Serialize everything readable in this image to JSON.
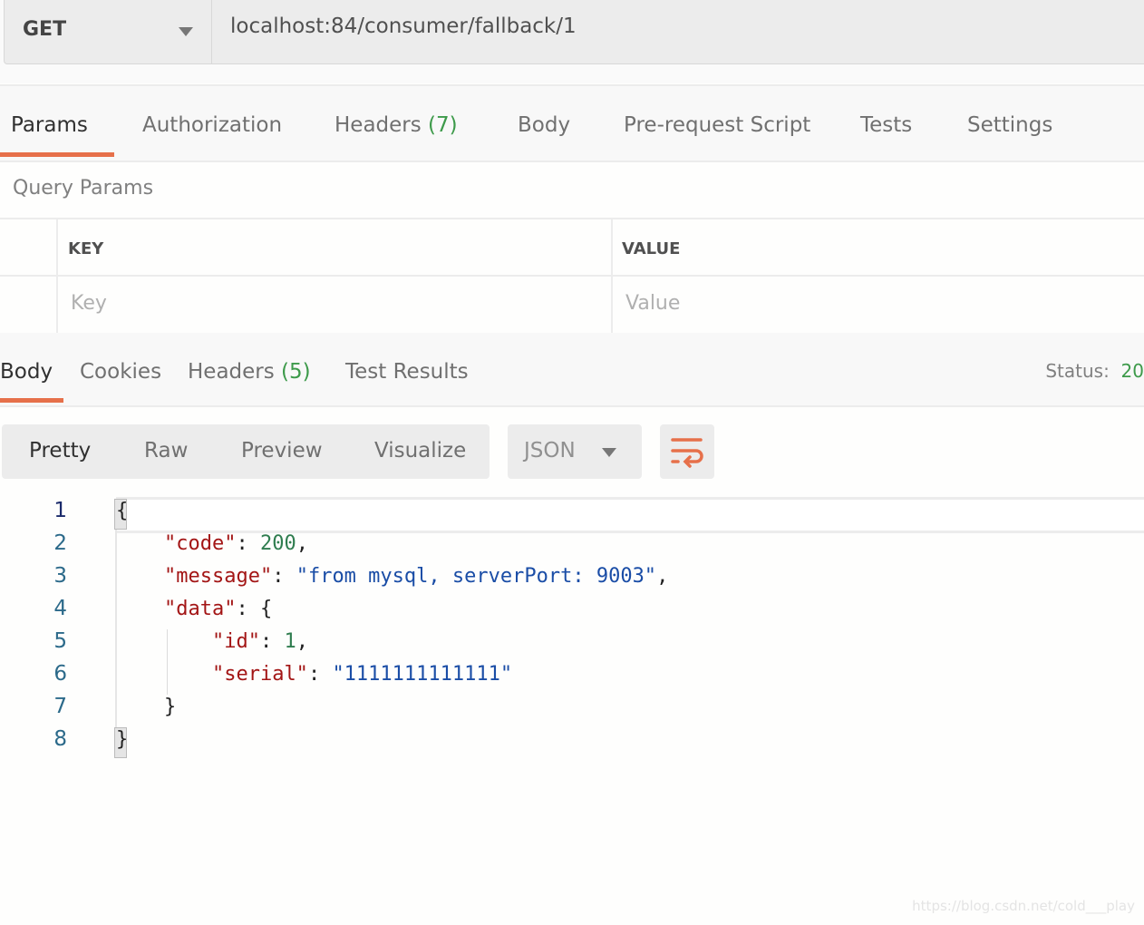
{
  "request": {
    "method": "GET",
    "url": "localhost:84/consumer/fallback/1"
  },
  "request_tabs": [
    {
      "label": "Params",
      "count": "",
      "active": true
    },
    {
      "label": "Authorization",
      "count": ""
    },
    {
      "label": "Headers",
      "count": "(7)"
    },
    {
      "label": "Body",
      "count": ""
    },
    {
      "label": "Pre-request Script",
      "count": ""
    },
    {
      "label": "Tests",
      "count": ""
    },
    {
      "label": "Settings",
      "count": ""
    }
  ],
  "query_params": {
    "title": "Query Params",
    "columns": [
      "KEY",
      "VALUE"
    ],
    "placeholders": {
      "key": "Key",
      "value": "Value"
    }
  },
  "response_tabs": [
    {
      "label": "Body",
      "count": "",
      "active": true
    },
    {
      "label": "Cookies",
      "count": ""
    },
    {
      "label": "Headers",
      "count": "(5)"
    },
    {
      "label": "Test Results",
      "count": ""
    }
  ],
  "status": {
    "label": "Status:",
    "value": "20"
  },
  "view_modes": [
    "Pretty",
    "Raw",
    "Preview",
    "Visualize"
  ],
  "active_view_mode": "Pretty",
  "format": "JSON",
  "wrap_icon": "wrap-lines-icon",
  "accent_color": "#e6704a",
  "code_lines": [
    [
      {
        "t": "{",
        "type": "punc"
      }
    ],
    [
      {
        "t": "    ",
        "type": "punc"
      },
      {
        "t": "\"code\"",
        "type": "key"
      },
      {
        "t": ": ",
        "type": "punc"
      },
      {
        "t": "200",
        "type": "num"
      },
      {
        "t": ",",
        "type": "punc"
      }
    ],
    [
      {
        "t": "    ",
        "type": "punc"
      },
      {
        "t": "\"message\"",
        "type": "key"
      },
      {
        "t": ": ",
        "type": "punc"
      },
      {
        "t": "\"from mysql, serverPort: 9003\"",
        "type": "str"
      },
      {
        "t": ",",
        "type": "punc"
      }
    ],
    [
      {
        "t": "    ",
        "type": "punc"
      },
      {
        "t": "\"data\"",
        "type": "key"
      },
      {
        "t": ": {",
        "type": "punc"
      }
    ],
    [
      {
        "t": "        ",
        "type": "punc"
      },
      {
        "t": "\"id\"",
        "type": "key"
      },
      {
        "t": ": ",
        "type": "punc"
      },
      {
        "t": "1",
        "type": "num"
      },
      {
        "t": ",",
        "type": "punc"
      }
    ],
    [
      {
        "t": "        ",
        "type": "punc"
      },
      {
        "t": "\"serial\"",
        "type": "key"
      },
      {
        "t": ": ",
        "type": "punc"
      },
      {
        "t": "\"1111111111111\"",
        "type": "str"
      }
    ],
    [
      {
        "t": "    }",
        "type": "punc"
      }
    ],
    [
      {
        "t": "}",
        "type": "punc"
      }
    ]
  ],
  "watermark": "https://blog.csdn.net/cold___play"
}
